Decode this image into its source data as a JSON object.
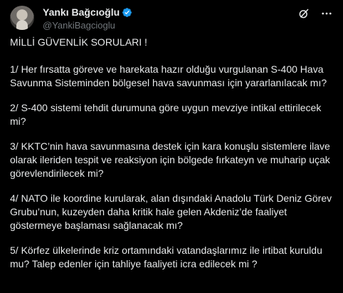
{
  "author": {
    "display_name": "Yankı Bağcıoğlu",
    "handle": "@YankiBagcioglu",
    "icons": [
      "verified-badge-icon",
      "grok-icon",
      "more-icon"
    ]
  },
  "colors": {
    "background": "#000000",
    "text": "#e7e9ea",
    "muted": "#71767b",
    "verified": "#1d9bf0"
  },
  "post": {
    "paragraphs": [
      "MİLLİ GÜVENLİK SORULARI !",
      "1/ Her fırsatta göreve ve harekata hazır olduğu vurgulanan S-400 Hava Savunma Sisteminden bölgesel hava savunması için yararlanılacak mı?",
      "2/ S-400 sistemi tehdit durumuna göre uygun mevziye intikal ettirilecek mi?",
      "3/ KKTC’nin hava savunmasına destek için kara konuşlu sistemlere ilave olarak ileriden tespit ve reaksiyon için bölgede fırkateyn ve muharip uçak görevlendirilecek mi?",
      "4/ NATO ile koordine kurularak, alan dışındaki Anadolu Türk Deniz Görev Grubu’nun, kuzeyden daha kritik hale gelen Akdeniz’de faaliyet göstermeye başlaması sağlanacak mı?",
      "5/ Körfez ülkelerinde kriz ortamındaki  vatandaşlarımız ile irtibat kuruldu mu? Talep edenler için tahliye faaliyeti icra edilecek mi ?"
    ]
  }
}
